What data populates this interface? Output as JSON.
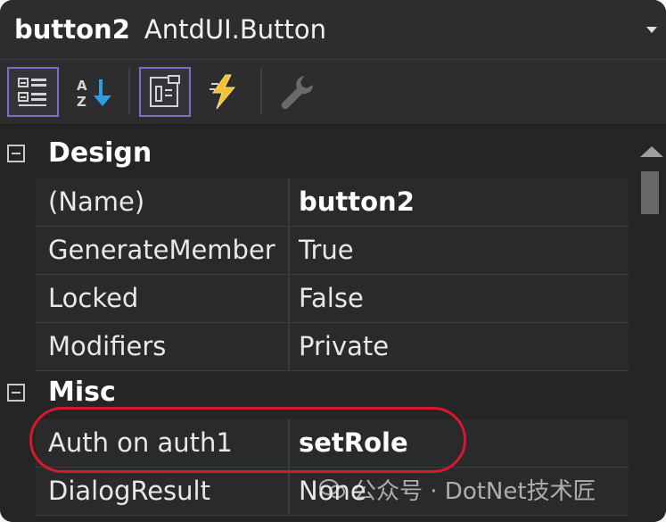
{
  "header": {
    "object_name": "button2",
    "object_type": "AntdUI.Button"
  },
  "toolbar": {
    "buttons": [
      {
        "icon": "categorized-icon",
        "active": true
      },
      {
        "icon": "alphabetical-sort-icon",
        "active": false
      },
      {
        "icon": "properties-icon",
        "active": true
      },
      {
        "icon": "events-lightning-icon",
        "active": false
      },
      {
        "icon": "property-pages-wrench-icon",
        "active": false,
        "disabled": true
      }
    ]
  },
  "categories": [
    {
      "label": "Design",
      "rows": [
        {
          "name": "(Name)",
          "value": "button2",
          "bold": true
        },
        {
          "name": "GenerateMember",
          "value": "True"
        },
        {
          "name": "Locked",
          "value": "False"
        },
        {
          "name": "Modifiers",
          "value": "Private"
        }
      ]
    },
    {
      "label": "Misc",
      "rows": [
        {
          "name": "Auth on auth1",
          "value": "setRole",
          "bold": true
        },
        {
          "name": "DialogResult",
          "value": "None"
        }
      ]
    }
  ],
  "watermark": {
    "text": "公众号 · DotNet技术匠"
  },
  "colors": {
    "background": "#252526",
    "toolbar": "#2d2d30",
    "active_border": "#7a6ec8",
    "highlight": "#d8182c"
  }
}
